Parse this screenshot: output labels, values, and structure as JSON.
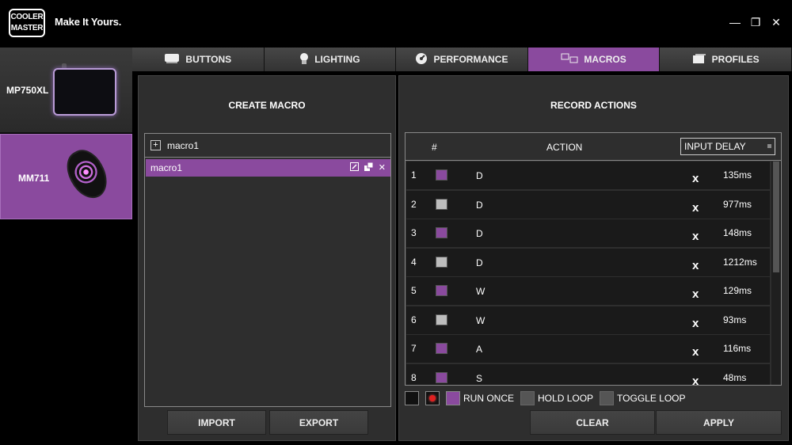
{
  "app": {
    "logo": "COOLER MASTER",
    "tagline": "Make It Yours."
  },
  "window_controls": {
    "minimize": "—",
    "restore": "❐",
    "close": "✕"
  },
  "devices": [
    {
      "label": "MP750XL"
    },
    {
      "label": "MM711"
    }
  ],
  "tabs": [
    {
      "label": "BUTTONS",
      "icon": "button-icon"
    },
    {
      "label": "LIGHTING",
      "icon": "lightbulb-icon"
    },
    {
      "label": "PERFORMANCE",
      "icon": "gauge-icon"
    },
    {
      "label": "MACROS",
      "icon": "macro-icon"
    },
    {
      "label": "PROFILES",
      "icon": "profiles-icon"
    }
  ],
  "active_tab": "MACROS",
  "left_panel": {
    "title": "CREATE MACRO",
    "header_name": "macro1",
    "selected_macro": "macro1",
    "import_label": "IMPORT",
    "export_label": "EXPORT"
  },
  "right_panel": {
    "title": "RECORD ACTIONS",
    "col_num": "#",
    "col_action": "ACTION",
    "delay_select": "INPUT DELAY",
    "rows": [
      {
        "n": "1",
        "state": "down",
        "key": "D",
        "delay": "135ms"
      },
      {
        "n": "2",
        "state": "up",
        "key": "D",
        "delay": "977ms"
      },
      {
        "n": "3",
        "state": "down",
        "key": "D",
        "delay": "148ms"
      },
      {
        "n": "4",
        "state": "up",
        "key": "D",
        "delay": "1212ms"
      },
      {
        "n": "5",
        "state": "down",
        "key": "W",
        "delay": "129ms"
      },
      {
        "n": "6",
        "state": "up",
        "key": "W",
        "delay": "93ms"
      },
      {
        "n": "7",
        "state": "down",
        "key": "A",
        "delay": "116ms"
      },
      {
        "n": "8",
        "state": "down",
        "key": "S",
        "delay": "48ms"
      }
    ],
    "options": {
      "run_once": "RUN ONCE",
      "hold_loop": "HOLD LOOP",
      "toggle_loop": "TOGGLE LOOP"
    },
    "clear_label": "CLEAR",
    "apply_label": "APPLY"
  },
  "colors": {
    "accent": "#8a4a9e",
    "background": "#000000",
    "panel": "#2e2e2e"
  }
}
